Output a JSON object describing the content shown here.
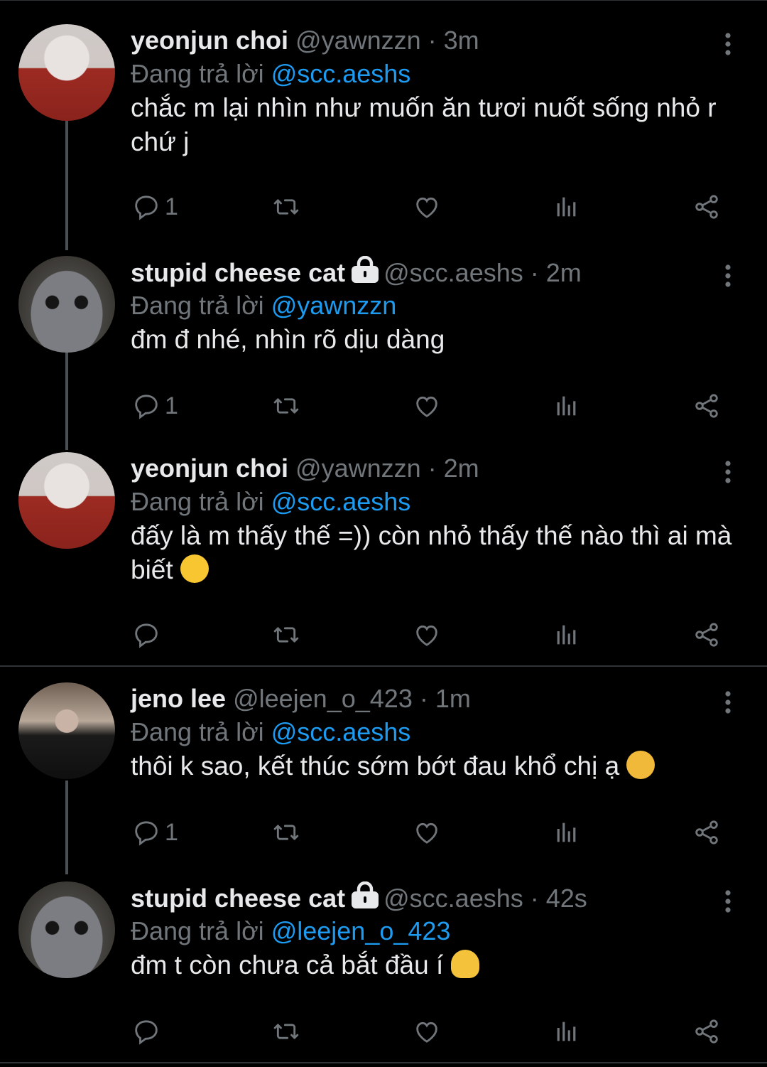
{
  "tweets": [
    {
      "name": "yeonjun choi",
      "handle": "@yawnzzn",
      "time": "3m",
      "replying_prefix": "Đang trả lời ",
      "replying_to": "@scc.aeshs",
      "text": "chắc m lại nhìn như muốn ăn tươi nuốt sống nhỏ r chứ j",
      "emoji": "",
      "reply_count": "1",
      "locked": false,
      "avatar": "avatar-yeonjun"
    },
    {
      "name": "stupid cheese cat",
      "handle": "@scc.aeshs",
      "time": "2m",
      "replying_prefix": "Đang trả lời ",
      "replying_to": "@yawnzzn",
      "text": "đm đ nhé, nhìn rõ dịu dàng",
      "emoji": "",
      "reply_count": "1",
      "locked": true,
      "avatar": "avatar-cat"
    },
    {
      "name": "yeonjun choi",
      "handle": "@yawnzzn",
      "time": "2m",
      "replying_prefix": "Đang trả lời ",
      "replying_to": "@scc.aeshs",
      "text": "đấy là m thấy thế =)) còn nhỏ thấy thế nào thì ai mà biết",
      "emoji": "laughing-tears-emoji",
      "reply_count": "",
      "locked": false,
      "avatar": "avatar-yeonjun"
    },
    {
      "name": "jeno lee",
      "handle": "@leejen_o_423",
      "time": "1m",
      "replying_prefix": "Đang trả lời ",
      "replying_to": "@scc.aeshs",
      "text": "thôi k sao, kết thúc sớm bớt đau khổ chị ạ",
      "emoji": "smiling-emoji",
      "reply_count": "1",
      "locked": false,
      "avatar": "avatar-jeno"
    },
    {
      "name": "stupid cheese cat",
      "handle": "@scc.aeshs",
      "time": "42s",
      "replying_prefix": "Đang trả lời ",
      "replying_to": "@leejen_o_423",
      "text": "đm t còn chưa cả bắt đầu í",
      "emoji": "melting-face-emoji",
      "reply_count": "",
      "locked": true,
      "avatar": "avatar-cat"
    }
  ],
  "separator": "·",
  "colors": {
    "background": "#000000",
    "text": "#e7e9ea",
    "secondary": "#71767b",
    "link": "#1d9bf0",
    "divider": "#2f3336"
  },
  "icons": [
    "reply-icon",
    "retweet-icon",
    "like-icon",
    "views-icon",
    "share-icon",
    "more-icon",
    "lock-icon"
  ]
}
